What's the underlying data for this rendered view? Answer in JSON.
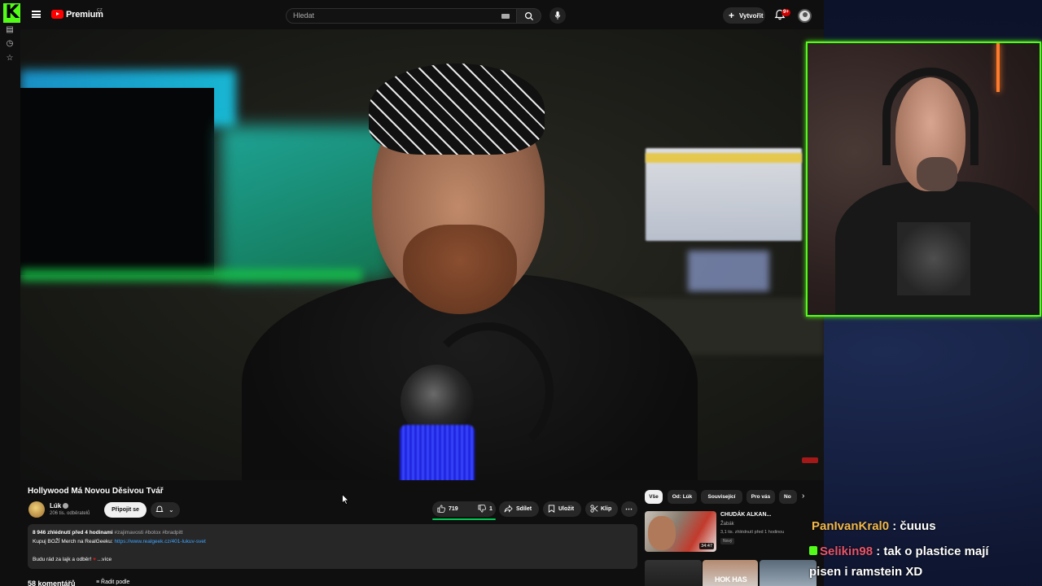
{
  "kick": {
    "logo": "K",
    "sidebar_icons": [
      "library-icon",
      "history-icon",
      "star-icon"
    ]
  },
  "youtube": {
    "brand": "Premium",
    "region": "CZ",
    "search": {
      "placeholder": "Hledat"
    },
    "create_label": "Vytvořit",
    "notif_count": "9+"
  },
  "video": {
    "title": "Hollywood Má Novou Děsivou Tvář",
    "channel": {
      "name": "Lúk",
      "subscribers": "206 tis. odběratelů",
      "join_label": "Připojit se"
    },
    "actions": {
      "likes": "719",
      "dislikes": "1",
      "share": "Sdílet",
      "save": "Uložit",
      "clip": "Klip"
    },
    "description": {
      "stats": "8 946 zhlédnutí  před 4 hodinami",
      "tags": "#zajimavosti #botox #bradpitt",
      "merch": "Kupuj BOŽÍ Merch na RealGeeku: ",
      "link": "https://www.realgeek.cz/401-lukuv-svet",
      "thanks": "Budu rád za lajk a odběr! ",
      "more": "...více"
    },
    "comments": {
      "count": "58 komentářů",
      "sort": "Řadit podle"
    }
  },
  "sidebar": {
    "chips": [
      "Vše",
      "Od: Lúk",
      "Související",
      "Pro vás",
      "No"
    ],
    "related": [
      {
        "title": "CHUDÁK ALKAN...",
        "channel": "Žabák",
        "meta": "3,1 tis. zhlédnutí  před 1 hodinou",
        "badge": "Nový",
        "duration": "34:47"
      }
    ],
    "thumb_text": "HOK HAS"
  },
  "chat": [
    {
      "user": "PanIvanKral0",
      "message": ": čuuus"
    },
    {
      "user": "Selikin98",
      "message": ": tak o plastice mají"
    },
    {
      "user": "",
      "message": "pisen i ramstein XD"
    }
  ],
  "colors": {
    "kick_green": "#53fc18",
    "yt_red": "#ff0000",
    "link_blue": "#3ea6ff",
    "like_bar": "#00c853"
  }
}
